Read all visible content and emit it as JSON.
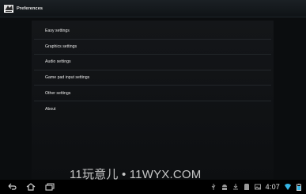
{
  "actionbar": {
    "title": "Preferences",
    "app_icon": "app-logo-icon"
  },
  "menu": {
    "items": [
      {
        "label": "Easy settings"
      },
      {
        "label": "Graphics settings"
      },
      {
        "label": "Audio settings"
      },
      {
        "label": "Game pad input settings"
      },
      {
        "label": "Other settings"
      },
      {
        "label": "About"
      }
    ]
  },
  "watermark": {
    "text": "11玩意儿 • 11WYX.COM"
  },
  "system_bar": {
    "nav": [
      "back-icon",
      "home-icon",
      "recent-apps-icon"
    ],
    "status_icons": [
      "usb-icon",
      "android-debug-icon",
      "download-icon",
      "sd-card-icon",
      "image-icon"
    ],
    "clock": "4:07",
    "signal_icons": [
      "wifi-icon",
      "battery-icon"
    ]
  },
  "colors": {
    "background": "#0b0d0f",
    "text": "#e6e6e6",
    "divider": "#23272b"
  }
}
